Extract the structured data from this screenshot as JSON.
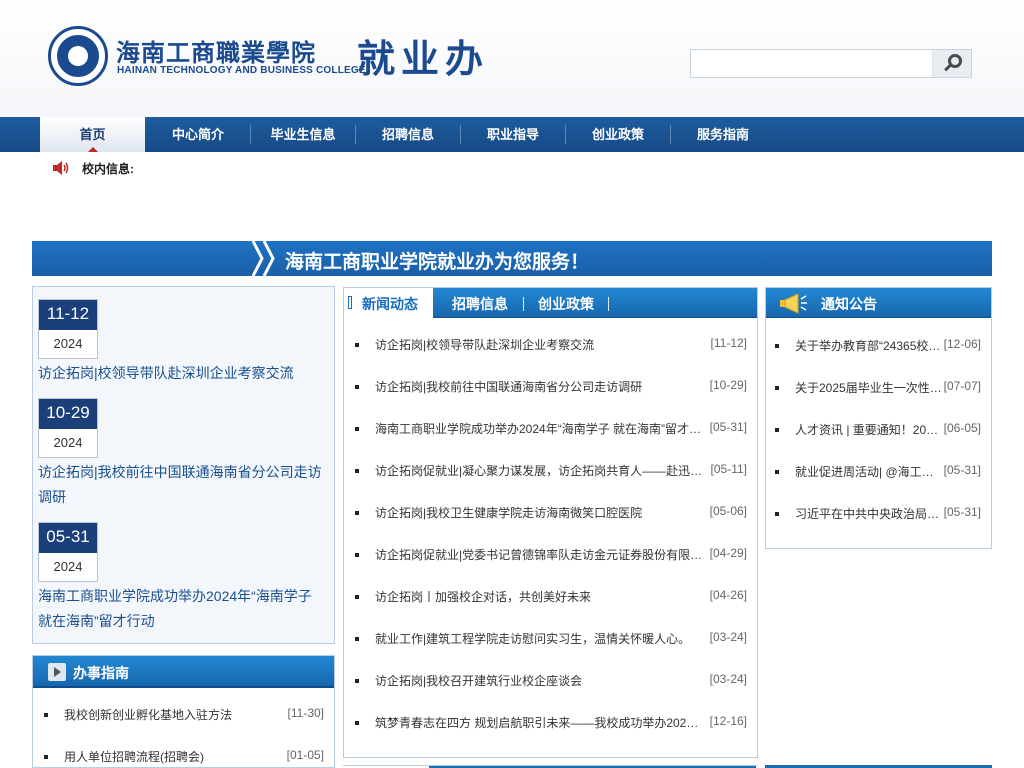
{
  "header": {
    "school_name_cn": "海南工商職業學院",
    "school_name_en": "HAINAN TECHNOLOGY AND BUSINESS COLLEGE",
    "office_title": "就业办",
    "search_placeholder": ""
  },
  "nav": {
    "items": [
      {
        "label": "首页",
        "active": true
      },
      {
        "label": "中心简介"
      },
      {
        "label": "毕业生信息"
      },
      {
        "label": "招聘信息"
      },
      {
        "label": "职业指导"
      },
      {
        "label": "创业政策"
      },
      {
        "label": "服务指南"
      }
    ]
  },
  "notice_bar": {
    "label": "校内信息:"
  },
  "banner": {
    "text": "海南工商职业学院就业办为您服务！"
  },
  "featured": [
    {
      "day": "11-12",
      "year": "2024",
      "title": "访企拓岗|校领导带队赴深圳企业考察交流"
    },
    {
      "day": "10-29",
      "year": "2024",
      "title": "访企拓岗|我校前往中国联通海南省分公司走访调研"
    },
    {
      "day": "05-31",
      "year": "2024",
      "title": "海南工商职业学院成功举办2024年“海南学子 就在海南”留才行动"
    }
  ],
  "guide": {
    "title": "办事指南",
    "items": [
      {
        "text": "我校创新创业孵化基地入驻方法",
        "date": "[11-30]"
      },
      {
        "text": "用人单位招聘流程(招聘会)",
        "date": "[01-05]"
      }
    ]
  },
  "news": {
    "tabs": [
      "新闻动态",
      "招聘信息",
      "创业政策"
    ],
    "items": [
      {
        "text": "访企拓岗|校领导带队赴深圳企业考察交流",
        "date": "[11-12]"
      },
      {
        "text": "访企拓岗|我校前往中国联通海南省分公司走访调研",
        "date": "[10-29]"
      },
      {
        "text": "海南工商职业学院成功举办2024年“海南学子 就在海南”留才…",
        "date": "[05-31]"
      },
      {
        "text": "访企拓岗促就业|凝心聚力谋发展，访企拓岗共育人——赴迅…",
        "date": "[05-11]"
      },
      {
        "text": "访企拓岗|我校卫生健康学院走访海南微笑口腔医院",
        "date": "[05-06]"
      },
      {
        "text": "访企拓岗促就业|党委书记曾德锦率队走访金元证券股份有限…",
        "date": "[04-29]"
      },
      {
        "text": "访企拓岗丨加强校企对话，共创美好未来",
        "date": "[04-26]"
      },
      {
        "text": "就业工作|建筑工程学院走访慰问实习生，温情关怀暖人心。",
        "date": "[03-24]"
      },
      {
        "text": "访企拓岗|我校召开建筑行业校企座谈会",
        "date": "[03-24]"
      },
      {
        "text": "筑梦青春志在四方 规划启航职引未来——我校成功举办2023…",
        "date": "[12-16]"
      }
    ]
  },
  "notices": {
    "title": "通知公告",
    "items": [
      {
        "text": "关于举办教育部“24365校…",
        "date": "[12-06]"
      },
      {
        "text": "关于2025届毕业生一次性…",
        "date": "[07-07]"
      },
      {
        "text": "人才资讯 | 重要通知！20…",
        "date": "[06-05]"
      },
      {
        "text": "就业促进周活动| @海工…",
        "date": "[05-31]"
      },
      {
        "text": "习近平在中共中央政治局…",
        "date": "[05-31]"
      }
    ]
  },
  "colors": {
    "brand_blue": "#1b4a8f",
    "nav_blue": "#1f5c9e",
    "panel_header": "#2388d3",
    "active_tab_text": "#1b6dbf"
  }
}
